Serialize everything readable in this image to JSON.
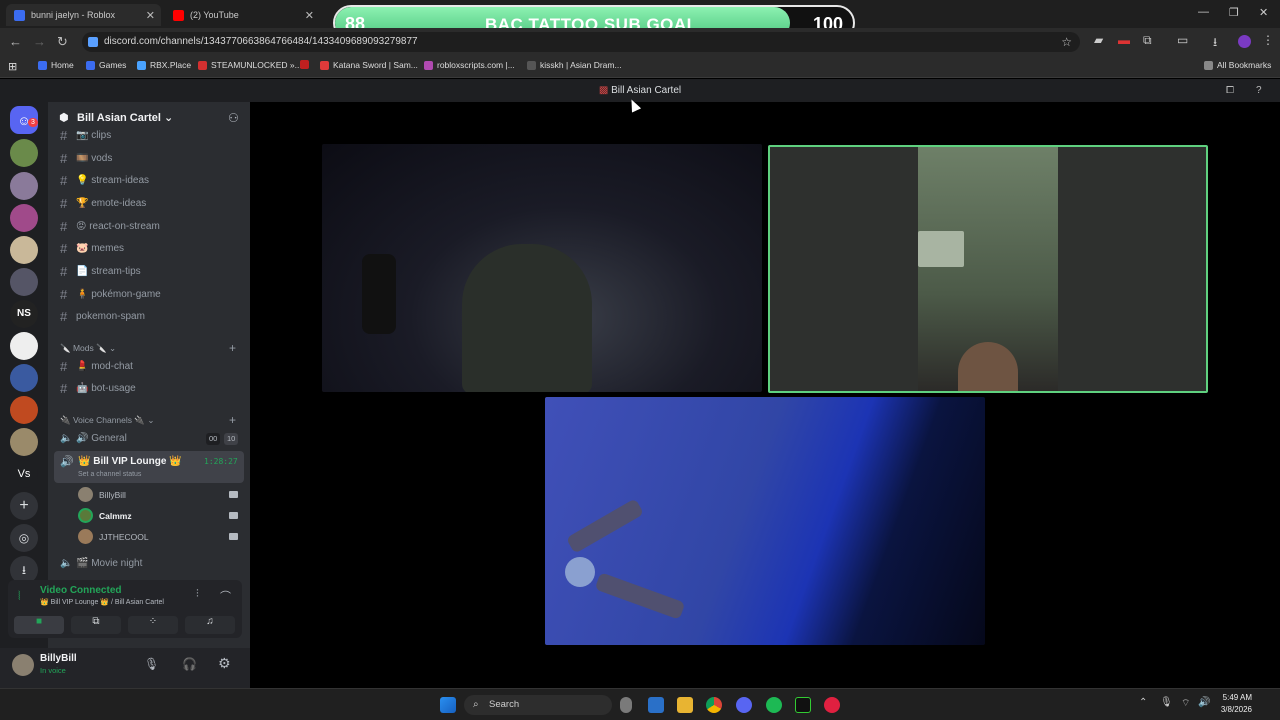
{
  "browser": {
    "tabs": [
      {
        "title": "bunni jaelyn - Roblox",
        "icon": "roblox-icon",
        "color": "#3b6cf0"
      },
      {
        "title": "(2) YouTube",
        "icon": "youtube-icon",
        "color": "#ff0000"
      }
    ],
    "url": "discord.com/channels/1343770663864766484/1433409689093279877",
    "bookmarks": [
      {
        "label": "Home",
        "color": "#3b6cf0"
      },
      {
        "label": "Games",
        "color": "#3b6cf0"
      },
      {
        "label": "RBX.Place",
        "color": "#4aa3ff"
      },
      {
        "label": "STEAMUNLOCKED »...",
        "color": "#d43030"
      },
      {
        "label": "",
        "color": "#c02020"
      },
      {
        "label": "Katana Sword | Sam...",
        "color": "#e03a3a"
      },
      {
        "label": "robloxscripts.com |...",
        "color": "#b04ab0"
      },
      {
        "label": "kisskh | Asian Dram...",
        "color": "#555"
      }
    ],
    "all_bookmarks": "All Bookmarks"
  },
  "overlay": {
    "goal_label": "BAC TATTOO SUB GOAL",
    "current": "88",
    "target": "100",
    "progress": 0.88
  },
  "discord": {
    "window_title": "Bill Asian Cartel",
    "mention_badge": "3",
    "server_name": "Bill Asian Cartel",
    "text_channels": [
      {
        "name": "📷 clips"
      },
      {
        "name": "🎞️ vods"
      },
      {
        "name": "💡 stream-ideas"
      },
      {
        "name": "🏆 emote-ideas"
      },
      {
        "name": "😡 react-on-stream"
      },
      {
        "name": "🐷 memes"
      },
      {
        "name": "📄 stream-tips"
      },
      {
        "name": "🧍 pokémon-game"
      },
      {
        "name": "pokemon-spam"
      }
    ],
    "mods_category": "🔪 Mods 🔪",
    "mod_channels": [
      {
        "name": "💄 mod-chat"
      },
      {
        "name": "🤖 bot-usage"
      }
    ],
    "voice_category": "🔌 Voice Channels 🔌",
    "voice_general": "🔊 General",
    "voice_general_counts": [
      "00",
      "10"
    ],
    "vip_lounge": "👑 Bill VIP Lounge 👑",
    "vip_timer": "1:28:27",
    "vip_status": "Set a channel status",
    "voice_users": [
      {
        "name": "BillyBill"
      },
      {
        "name": "Calmmz"
      },
      {
        "name": "JJTHECOOL"
      }
    ],
    "movie_night": "🎬 Movie night",
    "connection_status": "Video Connected",
    "connection_location": "👑 Bill VIP Lounge 👑 / Bill Asian Cartel",
    "user": {
      "name": "BillyBill",
      "status": "In voice"
    },
    "server_icon_label_ns": "NS",
    "server_icon_label_vs": "Vs"
  },
  "taskbar": {
    "search_placeholder": "Search",
    "time": "5:49 AM",
    "date": "3/8/2026"
  }
}
